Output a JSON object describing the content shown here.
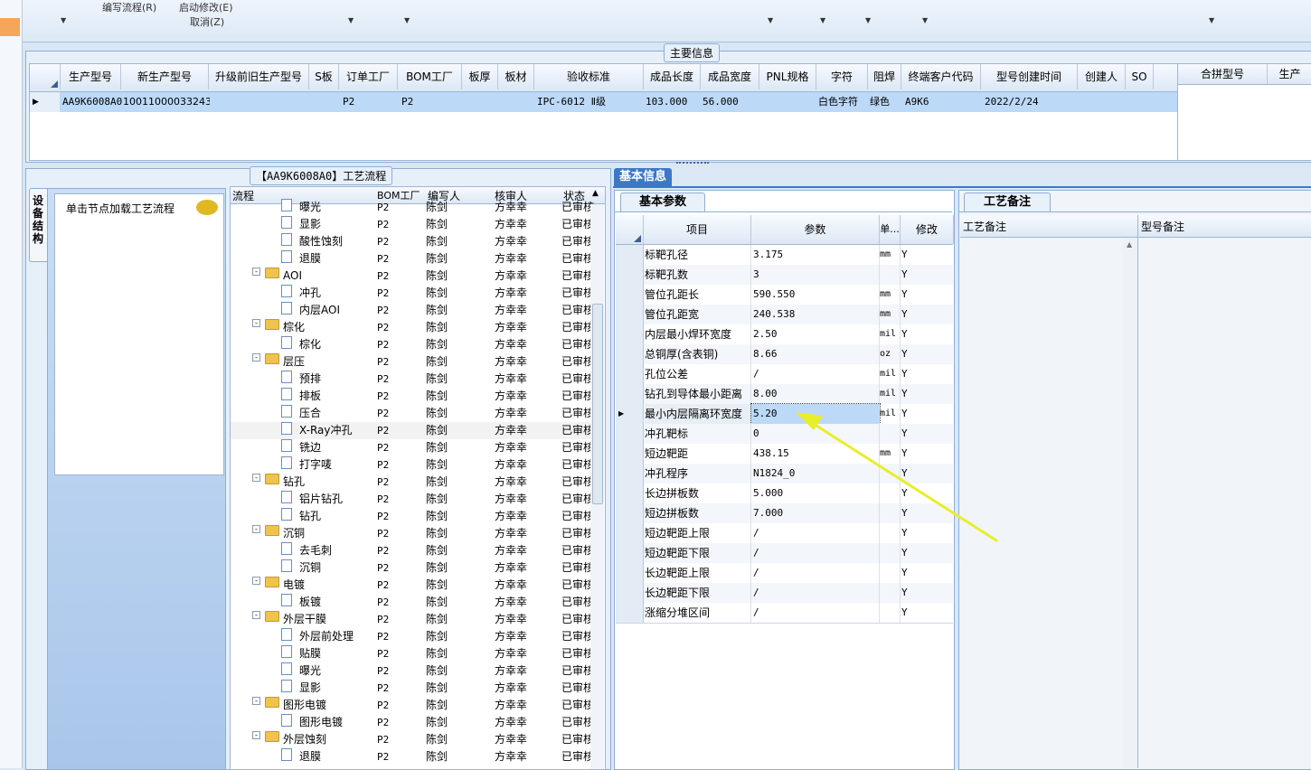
{
  "toolbar": {
    "items": [
      "编写流程(R)",
      "启动修改(E)",
      "取消(Z)"
    ]
  },
  "main_info": {
    "title": "主要信息",
    "columns": [
      "生产型号",
      "新生产型号",
      "升级前旧生产型号",
      "S板",
      "订单工厂",
      "BOM工厂",
      "板厚",
      "板材",
      "验收标准",
      "成品长度",
      "成品宽度",
      "PNL规格",
      "字符",
      "阻焊",
      "终端客户代码",
      "型号创建时间",
      "创建人",
      "SO"
    ],
    "row": [
      "AA9K6008A0",
      "10011000033243",
      "",
      "",
      "P2",
      "P2",
      "",
      "",
      "IPC-6012 Ⅱ级",
      "103.000",
      "56.000",
      "",
      "白色字符",
      "绿色",
      "A9K6",
      "2022/2/24",
      "",
      ""
    ],
    "side_columns": [
      "合拼型号",
      "生产"
    ]
  },
  "process": {
    "title": "【AA9K6008A0】工艺流程",
    "side_tab": "设备结构",
    "hint": "单击节点加载工艺流程",
    "columns": [
      "流程",
      "BOM工厂",
      "编写人",
      "核审人",
      "状态"
    ],
    "rows": [
      {
        "name": "曝光",
        "level": 2,
        "bom": "P2",
        "writer": "陈剑",
        "reviewer": "方幸幸",
        "status": "已审核"
      },
      {
        "name": "显影",
        "level": 2,
        "bom": "P2",
        "writer": "陈剑",
        "reviewer": "方幸幸",
        "status": "已审核"
      },
      {
        "name": "酸性蚀刻",
        "level": 2,
        "bom": "P2",
        "writer": "陈剑",
        "reviewer": "方幸幸",
        "status": "已审核"
      },
      {
        "name": "退膜",
        "level": 2,
        "bom": "P2",
        "writer": "陈剑",
        "reviewer": "方幸幸",
        "status": "已审核"
      },
      {
        "name": "AOI",
        "level": 1,
        "bom": "P2",
        "writer": "陈剑",
        "reviewer": "方幸幸",
        "status": "已审核"
      },
      {
        "name": "冲孔",
        "level": 2,
        "bom": "P2",
        "writer": "陈剑",
        "reviewer": "方幸幸",
        "status": "已审核"
      },
      {
        "name": "内层AOI",
        "level": 2,
        "bom": "P2",
        "writer": "陈剑",
        "reviewer": "方幸幸",
        "status": "已审核"
      },
      {
        "name": "棕化",
        "level": 1,
        "bom": "P2",
        "writer": "陈剑",
        "reviewer": "方幸幸",
        "status": "已审核"
      },
      {
        "name": "棕化",
        "level": 2,
        "bom": "P2",
        "writer": "陈剑",
        "reviewer": "方幸幸",
        "status": "已审核"
      },
      {
        "name": "层压",
        "level": 1,
        "bom": "P2",
        "writer": "陈剑",
        "reviewer": "方幸幸",
        "status": "已审核"
      },
      {
        "name": "预排",
        "level": 2,
        "bom": "P2",
        "writer": "陈剑",
        "reviewer": "方幸幸",
        "status": "已审核"
      },
      {
        "name": "排板",
        "level": 2,
        "bom": "P2",
        "writer": "陈剑",
        "reviewer": "方幸幸",
        "status": "已审核"
      },
      {
        "name": "压合",
        "level": 2,
        "bom": "P2",
        "writer": "陈剑",
        "reviewer": "方幸幸",
        "status": "已审核"
      },
      {
        "name": "X-Ray冲孔",
        "level": 2,
        "bom": "P2",
        "writer": "陈剑",
        "reviewer": "方幸幸",
        "status": "已审核"
      },
      {
        "name": "铣边",
        "level": 2,
        "bom": "P2",
        "writer": "陈剑",
        "reviewer": "方幸幸",
        "status": "已审核"
      },
      {
        "name": "打字唛",
        "level": 2,
        "bom": "P2",
        "writer": "陈剑",
        "reviewer": "方幸幸",
        "status": "已审核"
      },
      {
        "name": "钻孔",
        "level": 1,
        "bom": "P2",
        "writer": "陈剑",
        "reviewer": "方幸幸",
        "status": "已审核"
      },
      {
        "name": "铝片钻孔",
        "level": 2,
        "bom": "P2",
        "writer": "陈剑",
        "reviewer": "方幸幸",
        "status": "已审核"
      },
      {
        "name": "钻孔",
        "level": 2,
        "bom": "P2",
        "writer": "陈剑",
        "reviewer": "方幸幸",
        "status": "已审核"
      },
      {
        "name": "沉铜",
        "level": 1,
        "bom": "P2",
        "writer": "陈剑",
        "reviewer": "方幸幸",
        "status": "已审核"
      },
      {
        "name": "去毛刺",
        "level": 2,
        "bom": "P2",
        "writer": "陈剑",
        "reviewer": "方幸幸",
        "status": "已审核"
      },
      {
        "name": "沉铜",
        "level": 2,
        "bom": "P2",
        "writer": "陈剑",
        "reviewer": "方幸幸",
        "status": "已审核"
      },
      {
        "name": "电镀",
        "level": 1,
        "bom": "P2",
        "writer": "陈剑",
        "reviewer": "方幸幸",
        "status": "已审核"
      },
      {
        "name": "板镀",
        "level": 2,
        "bom": "P2",
        "writer": "陈剑",
        "reviewer": "方幸幸",
        "status": "已审核"
      },
      {
        "name": "外层干膜",
        "level": 1,
        "bom": "P2",
        "writer": "陈剑",
        "reviewer": "方幸幸",
        "status": "已审核"
      },
      {
        "name": "外层前处理",
        "level": 2,
        "bom": "P2",
        "writer": "陈剑",
        "reviewer": "方幸幸",
        "status": "已审核"
      },
      {
        "name": "贴膜",
        "level": 2,
        "bom": "P2",
        "writer": "陈剑",
        "reviewer": "方幸幸",
        "status": "已审核"
      },
      {
        "name": "曝光",
        "level": 2,
        "bom": "P2",
        "writer": "陈剑",
        "reviewer": "方幸幸",
        "status": "已审核"
      },
      {
        "name": "显影",
        "level": 2,
        "bom": "P2",
        "writer": "陈剑",
        "reviewer": "方幸幸",
        "status": "已审核"
      },
      {
        "name": "图形电镀",
        "level": 1,
        "bom": "P2",
        "writer": "陈剑",
        "reviewer": "方幸幸",
        "status": "已审核"
      },
      {
        "name": "图形电镀",
        "level": 2,
        "bom": "P2",
        "writer": "陈剑",
        "reviewer": "方幸幸",
        "status": "已审核"
      },
      {
        "name": "外层蚀刻",
        "level": 1,
        "bom": "P2",
        "writer": "陈剑",
        "reviewer": "方幸幸",
        "status": "已审核"
      },
      {
        "name": "退膜",
        "level": 2,
        "bom": "P2",
        "writer": "陈剑",
        "reviewer": "方幸幸",
        "status": "已审核"
      }
    ]
  },
  "basic_info": {
    "tab": "基本信息",
    "params_tab": "基本参数",
    "columns": [
      "项目",
      "参数",
      "单...",
      "修改"
    ],
    "rows": [
      {
        "item": "标靶孔径",
        "value": "3.175",
        "unit": "mm",
        "mod": "Y"
      },
      {
        "item": "标靶孔数",
        "value": "3",
        "unit": "",
        "mod": "Y"
      },
      {
        "item": "管位孔距长",
        "value": "590.550",
        "unit": "mm",
        "mod": "Y"
      },
      {
        "item": "管位孔距宽",
        "value": "240.538",
        "unit": "mm",
        "mod": "Y"
      },
      {
        "item": "内层最小焊环宽度",
        "value": "2.50",
        "unit": "mil",
        "mod": "Y"
      },
      {
        "item": "总铜厚(含表铜)",
        "value": "8.66",
        "unit": "oz",
        "mod": "Y"
      },
      {
        "item": "孔位公差",
        "value": "/",
        "unit": "mil",
        "mod": "Y"
      },
      {
        "item": "钻孔到导体最小距离",
        "value": "8.00",
        "unit": "mil",
        "mod": "Y"
      },
      {
        "item": "最小内层隔离环宽度",
        "value": "5.20",
        "unit": "mil",
        "mod": "Y"
      },
      {
        "item": "冲孔靶标",
        "value": "0",
        "unit": "",
        "mod": "Y"
      },
      {
        "item": "短边靶距",
        "value": "438.15",
        "unit": "mm",
        "mod": "Y"
      },
      {
        "item": "冲孔程序",
        "value": "N1824_0",
        "unit": "",
        "mod": "Y"
      },
      {
        "item": "长边拼板数",
        "value": "5.000",
        "unit": "",
        "mod": "Y"
      },
      {
        "item": "短边拼板数",
        "value": "7.000",
        "unit": "",
        "mod": "Y"
      },
      {
        "item": "短边靶距上限",
        "value": "/",
        "unit": "",
        "mod": "Y"
      },
      {
        "item": "短边靶距下限",
        "value": "/",
        "unit": "",
        "mod": "Y"
      },
      {
        "item": "长边靶距上限",
        "value": "/",
        "unit": "",
        "mod": "Y"
      },
      {
        "item": "长边靶距下限",
        "value": "/",
        "unit": "",
        "mod": "Y"
      },
      {
        "item": "涨缩分堆区间",
        "value": "/",
        "unit": "",
        "mod": "Y"
      }
    ]
  },
  "process_notes": {
    "tab": "工艺备注",
    "columns": [
      "工艺备注",
      "型号备注"
    ]
  }
}
